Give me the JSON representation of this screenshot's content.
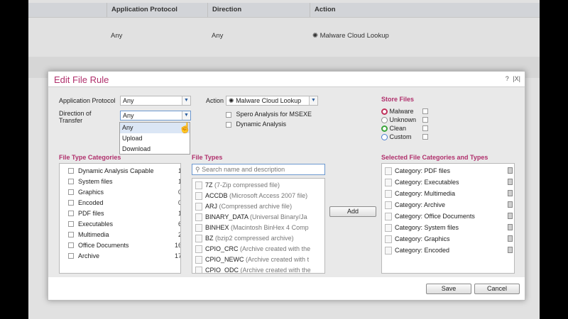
{
  "background": {
    "columns": [
      "Application Protocol",
      "Direction",
      "Action"
    ],
    "row": {
      "application_protocol": "Any",
      "direction": "Any",
      "action": "Malware Cloud Lookup"
    }
  },
  "dialog": {
    "title": "Edit File Rule",
    "help_glyph": "?",
    "close_glyph": "X",
    "application_protocol": {
      "label": "Application Protocol",
      "value": "Any"
    },
    "direction": {
      "label_line1": "Direction of",
      "label_line2": "Transfer",
      "value": "Any",
      "options": [
        "Any",
        "Upload",
        "Download"
      ],
      "highlighted": "Any"
    },
    "action": {
      "label": "Action",
      "value": "Malware Cloud Lookup"
    },
    "options": [
      {
        "label": "Spero Analysis for MSEXE",
        "checked": false
      },
      {
        "label": "Dynamic Analysis",
        "checked": false
      }
    ],
    "store_files": {
      "title": "Store Files",
      "items": [
        {
          "label": "Malware",
          "color": "#c0305a",
          "checked": false
        },
        {
          "label": "Unknown",
          "color": "#8f8f8f",
          "checked": false
        },
        {
          "label": "Clean",
          "color": "#3aa53a",
          "checked": false
        },
        {
          "label": "Custom",
          "color": "#4a7fd0",
          "checked": false
        }
      ]
    },
    "file_type_categories": {
      "title": "File Type Categories",
      "items": [
        {
          "name": "Dynamic Analysis Capable",
          "count": "1"
        },
        {
          "name": "System files",
          "count": "1"
        },
        {
          "name": "Graphics",
          "count": "0"
        },
        {
          "name": "Encoded",
          "count": "0"
        },
        {
          "name": "PDF files",
          "count": "1"
        },
        {
          "name": "Executables",
          "count": "6"
        },
        {
          "name": "Multimedia",
          "count": "2"
        },
        {
          "name": "Office Documents",
          "count": "16"
        },
        {
          "name": "Archive",
          "count": "17"
        }
      ]
    },
    "file_types": {
      "title": "File Types",
      "search_placeholder": "Search name and description",
      "items": [
        {
          "name": "7Z",
          "desc": "(7-Zip compressed file)"
        },
        {
          "name": "ACCDB",
          "desc": "(Microsoft Access 2007 file)"
        },
        {
          "name": "ARJ",
          "desc": "(Compressed archive file)"
        },
        {
          "name": "BINARY_DATA",
          "desc": "(Universal Binary/Ja"
        },
        {
          "name": "BINHEX",
          "desc": "(Macintosh BinHex 4 Comp"
        },
        {
          "name": "BZ",
          "desc": "(bzip2 compressed archive)"
        },
        {
          "name": "CPIO_CRC",
          "desc": "(Archive created with the"
        },
        {
          "name": "CPIO_NEWC",
          "desc": "(Archive created with t"
        },
        {
          "name": "CPIO_ODC",
          "desc": "(Archive created with the"
        }
      ]
    },
    "add_button": "Add",
    "selected": {
      "title": "Selected File Categories and Types",
      "items": [
        "Category: PDF files",
        "Category: Executables",
        "Category: Multimedia",
        "Category: Archive",
        "Category: Office Documents",
        "Category: System files",
        "Category: Graphics",
        "Category: Encoded"
      ]
    },
    "save_button": "Save",
    "cancel_button": "Cancel"
  }
}
